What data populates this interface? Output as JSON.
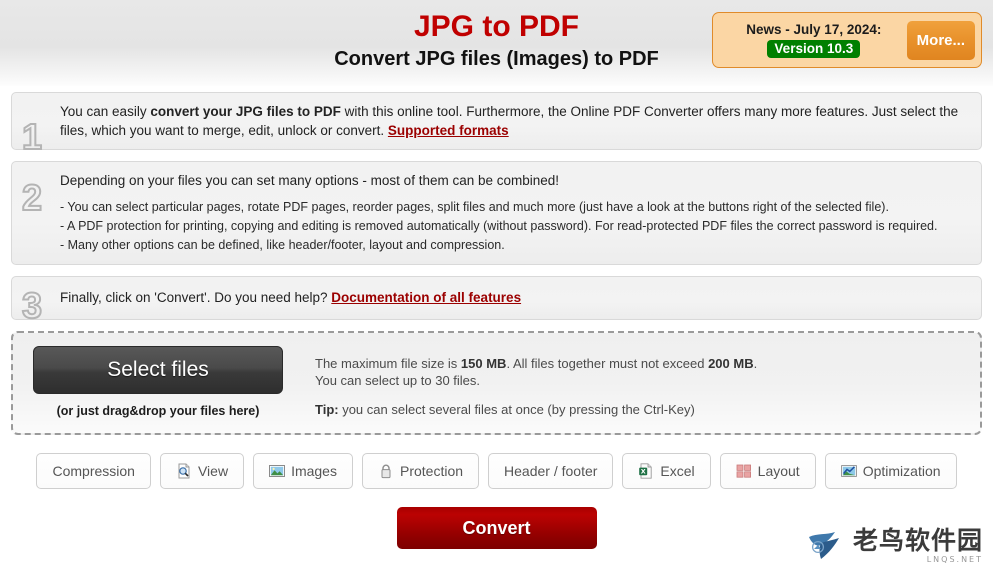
{
  "header": {
    "title_main": "JPG to PDF",
    "title_sub": "Convert JPG files (Images) to PDF",
    "news": {
      "date_label": "News - July 17, 2024:",
      "version_badge": "Version 10.3",
      "more_label": "More...",
      "badge_color": "#008000",
      "box_color": "#fbd6a4",
      "more_color": "#e8912b"
    },
    "title_color": "#c00000"
  },
  "steps": [
    {
      "number": "1",
      "text_parts": [
        "You can easily ",
        "convert your JPG files to PDF",
        " with this online tool. Furthermore, the Online PDF Converter offers many more features. Just select the files, which you want to merge, edit, unlock or convert. "
      ],
      "link": "Supported formats"
    },
    {
      "number": "2",
      "heading": "Depending on your files you can set many options - most of them can be combined!",
      "bullets": [
        "- You can select particular pages, rotate PDF pages, reorder pages, split files and much more (just have a look at the buttons right of the selected file).",
        "- A PDF protection for printing, copying and editing is removed automatically (without password). For read-protected PDF files the correct password is required.",
        "- Many other options can be defined, like header/footer, layout and compression."
      ]
    },
    {
      "number": "3",
      "text": "Finally, click on 'Convert'. Do you need help? ",
      "link": "Documentation of all features"
    }
  ],
  "dropzone": {
    "select_button": "Select files",
    "drag_hint": "(or just drag&drop your files here)",
    "info_prefix": "The maximum file size is ",
    "info_size1": "150 MB",
    "info_mid": ". All files together must not exceed ",
    "info_size2": "200 MB",
    "info_suffix": ".",
    "info_line2": "You can select up to 30 files.",
    "tip_label": "Tip:",
    "tip_text": " you can select several files at once (by pressing the Ctrl-Key)"
  },
  "toolbar": [
    {
      "label": "Compression",
      "icon": "none"
    },
    {
      "label": "View",
      "icon": "magnifier-page-icon"
    },
    {
      "label": "Images",
      "icon": "picture-icon"
    },
    {
      "label": "Protection",
      "icon": "padlock-icon"
    },
    {
      "label": "Header / footer",
      "icon": "none"
    },
    {
      "label": "Excel",
      "icon": "excel-icon"
    },
    {
      "label": "Layout",
      "icon": "grid-squares-icon"
    },
    {
      "label": "Optimization",
      "icon": "chart-icon"
    }
  ],
  "convert": {
    "label": "Convert",
    "color": "#a80000"
  },
  "watermark": {
    "text": "老鸟软件园",
    "sub": "LNQS.NET"
  }
}
